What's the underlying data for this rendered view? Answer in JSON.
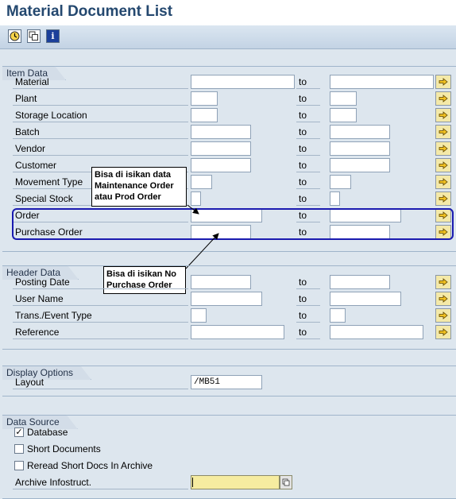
{
  "title": "Material Document List",
  "toolbar": {
    "execute_icon": "clock-execute-icon",
    "variants_icon": "copy-variants-icon",
    "info_glyph": "i"
  },
  "item_data": {
    "title": "Item Data",
    "rows": [
      {
        "label": "Material",
        "to": "to",
        "low": "",
        "high": ""
      },
      {
        "label": "Plant",
        "to": "to",
        "low": "",
        "high": ""
      },
      {
        "label": "Storage Location",
        "to": "to",
        "low": "",
        "high": ""
      },
      {
        "label": "Batch",
        "to": "to",
        "low": "",
        "high": ""
      },
      {
        "label": "Vendor",
        "to": "to",
        "low": "",
        "high": ""
      },
      {
        "label": "Customer",
        "to": "to",
        "low": "",
        "high": ""
      },
      {
        "label": "Movement Type",
        "to": "to",
        "low": "",
        "high": ""
      },
      {
        "label": "Special Stock",
        "to": "to",
        "low": "",
        "high": ""
      },
      {
        "label": "Order",
        "to": "to",
        "low": "",
        "high": ""
      },
      {
        "label": "Purchase Order",
        "to": "to",
        "low": "",
        "high": ""
      }
    ]
  },
  "header_data": {
    "title": "Header Data",
    "rows": [
      {
        "label": "Posting Date",
        "to": "to",
        "low": "",
        "high": ""
      },
      {
        "label": "User Name",
        "to": "to",
        "low": "",
        "high": ""
      },
      {
        "label": "Trans./Event Type",
        "to": "to",
        "low": "",
        "high": ""
      },
      {
        "label": "Reference",
        "to": "to",
        "low": "",
        "high": ""
      }
    ]
  },
  "display_options": {
    "title": "Display Options",
    "layout_label": "Layout",
    "layout_value": "/MB51"
  },
  "data_source": {
    "title": "Data Source",
    "database": {
      "label": "Database",
      "checked": true
    },
    "short_documents": {
      "label": "Short Documents",
      "checked": false
    },
    "reread": {
      "label": "Reread Short Docs In Archive",
      "checked": false
    },
    "archive_label": "Archive Infostruct.",
    "archive_value": ""
  },
  "annotations": {
    "callout_order": [
      "Bisa di isikan data",
      "Maintenance Order",
      "atau Prod Order"
    ],
    "callout_po": [
      "Bisa di isikan No",
      "Purchase Order"
    ],
    "highlight_color": "#1b1bb0"
  },
  "colors": {
    "title": "#24486f",
    "background": "#dde6ee",
    "multiselect": "#f4e9a8",
    "archive_field": "#f6eca0"
  }
}
